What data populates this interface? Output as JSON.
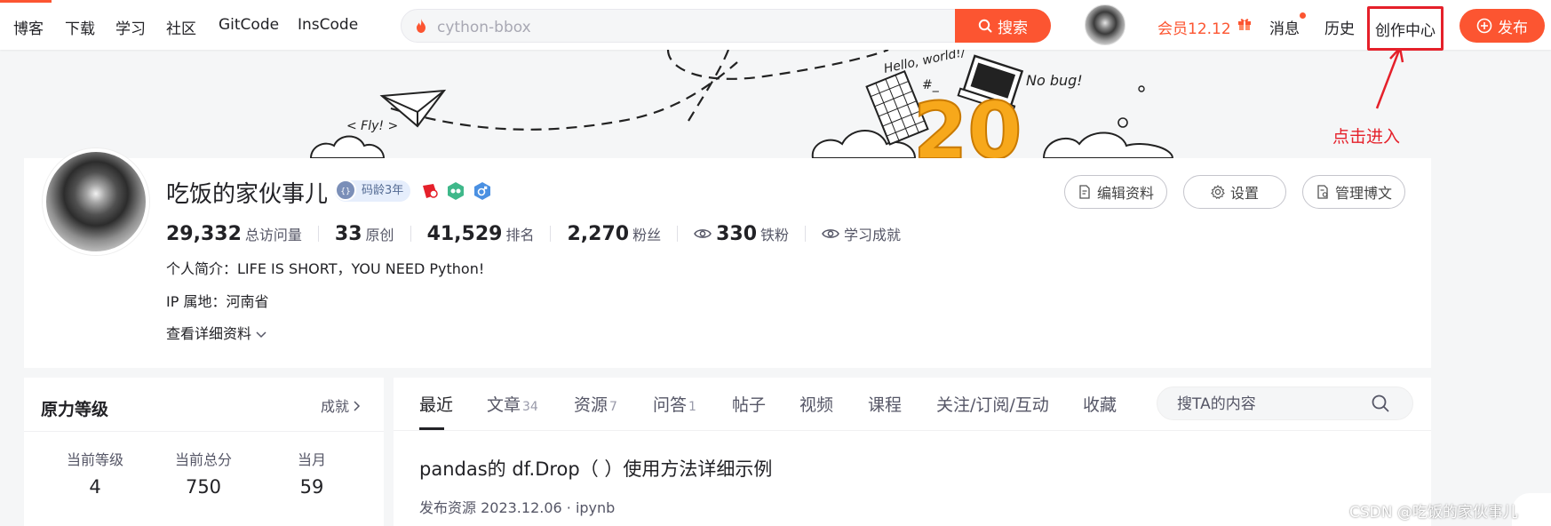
{
  "nav": {
    "items": [
      "博客",
      "下载",
      "学习",
      "社区",
      "GitCode",
      "InsCode"
    ],
    "search_placeholder": "cython-bbox",
    "search_button": "搜索",
    "vip": "会员12.12",
    "messages": "消息",
    "history": "历史",
    "creation_center": "创作中心",
    "publish": "发布"
  },
  "banner": {
    "fly_text": "< Fly! >",
    "hello_text": "Hello, world!/",
    "nobug_text": "No bug!",
    "twenty": "20"
  },
  "annotation": "点击进入",
  "profile": {
    "name": "吃饭的家伙事儿",
    "badge_years": "码龄3年",
    "stats": [
      {
        "value": "29,332",
        "label": "总访问量"
      },
      {
        "value": "33",
        "label": "原创"
      },
      {
        "value": "41,529",
        "label": "排名"
      },
      {
        "value": "2,270",
        "label": "粉丝"
      }
    ],
    "iron_fans": {
      "value": "330",
      "label": "铁粉"
    },
    "achievement": "学习成就",
    "bio": "个人简介：LIFE IS SHORT，YOU NEED Python!",
    "ip": "IP 属地：河南省",
    "more_info": "查看详细资料",
    "buttons": {
      "edit": "编辑资料",
      "settings": "设置",
      "manage": "管理博文"
    }
  },
  "sidebar": {
    "title": "原力等级",
    "more": "成就",
    "levels": [
      {
        "label": "当前等级",
        "value": "4"
      },
      {
        "label": "当前总分",
        "value": "750"
      },
      {
        "label": "当月",
        "value": "59"
      }
    ]
  },
  "main": {
    "tabs": [
      {
        "label": "最近",
        "count": ""
      },
      {
        "label": "文章",
        "count": "34"
      },
      {
        "label": "资源",
        "count": "7"
      },
      {
        "label": "问答",
        "count": "1"
      },
      {
        "label": "帖子",
        "count": ""
      },
      {
        "label": "视频",
        "count": ""
      },
      {
        "label": "课程",
        "count": ""
      },
      {
        "label": "关注/订阅/互动",
        "count": ""
      },
      {
        "label": "收藏",
        "count": ""
      }
    ],
    "search_placeholder": "搜TA的内容",
    "article": {
      "title": "pandas的 df.Drop（ ）使用方法详细示例",
      "meta": "发布资源 2023.12.06 · ipynb"
    }
  },
  "watermark": "CSDN @吃饭的家伙事儿",
  "colors": {
    "accent": "#fc5531",
    "annotation": "#e5202a"
  }
}
